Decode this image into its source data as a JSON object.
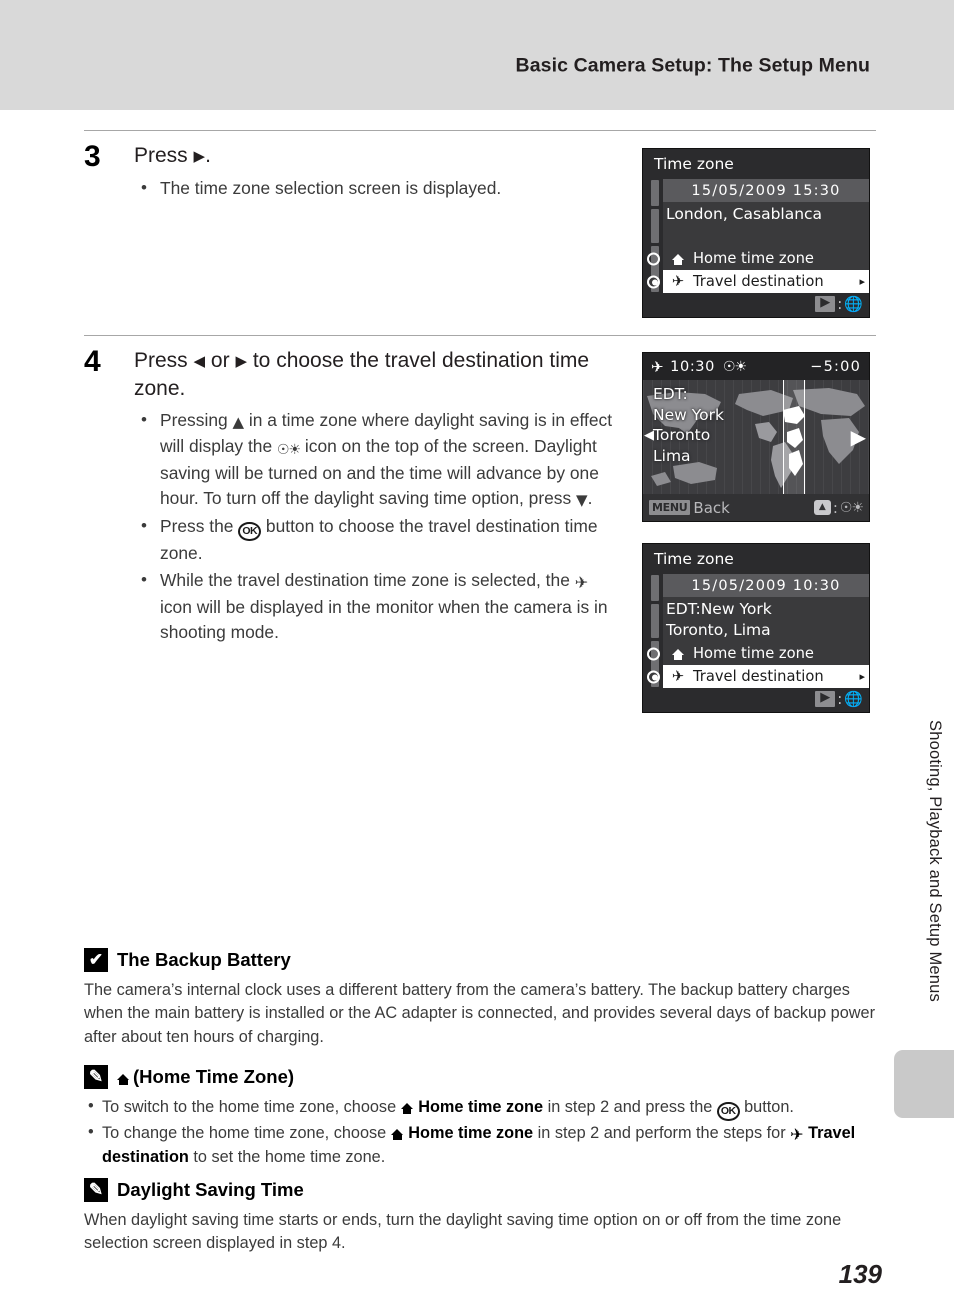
{
  "header": {
    "title": "Basic Camera Setup: The Setup Menu"
  },
  "steps": [
    {
      "number": "3",
      "title_pre": "Press",
      "title_icon": "▶",
      "title_post": ".",
      "bullets": [
        {
          "text": "The time zone selection screen is displayed."
        }
      ]
    },
    {
      "number": "4",
      "title_line1_a": "Press",
      "title_icon_left": "◀",
      "title_or": "or",
      "title_icon_right": "▶",
      "title_line1_b": "to choose the travel destination",
      "title_line2": "time zone.",
      "bullets": [
        {
          "p1": "Pressing",
          "icon1": "▲",
          "p2": "in a time zone where daylight saving is in effect will display the",
          "icon2": "dst-icon",
          "p3": "icon on the top of the screen. Daylight saving will be turned on and the time will advance by one hour. To turn off the daylight saving time option, press",
          "icon3": "▼",
          "p4": "."
        },
        {
          "p1": "Press the",
          "icon1": "OK",
          "p2": "button to choose the travel destination time zone."
        },
        {
          "p1": "While the travel destination time zone is selected, the",
          "icon1": "travel-plane-icon",
          "p2": "icon will be displayed in the monitor when the camera is in shooting mode."
        }
      ]
    }
  ],
  "screens": {
    "menu_home": {
      "title": "Time zone",
      "datetime": "15/05/2009  15:30",
      "location_lines": [
        "London, Casablanca"
      ],
      "options": [
        {
          "label": "Home time zone",
          "icon": "home-icon",
          "selected": false
        },
        {
          "label": "Travel destination",
          "icon": "plane-icon",
          "selected": true,
          "arrow": "▸"
        }
      ],
      "footer": {
        "button": "▶",
        "sep": ":",
        "icon": "globe-icon"
      }
    },
    "map": {
      "top": {
        "plane_icon": "✈",
        "time": "10:30",
        "dst_icon": "dst-icon",
        "offset": "−5:00"
      },
      "cities": [
        "EDT:",
        "New York",
        "Toronto",
        "Lima"
      ],
      "cursor_left": "◀",
      "cursor_right": "▶",
      "footer": {
        "menu": "MENU",
        "back": "Back",
        "pad": "⬍",
        "sep": ":",
        "icon": "dst-icon"
      }
    },
    "menu_travel": {
      "title": "Time zone",
      "datetime": "15/05/2009  10:30",
      "location_lines": [
        "EDT:New York",
        "Toronto, Lima"
      ],
      "options": [
        {
          "label": "Home time zone",
          "icon": "home-icon",
          "selected": false
        },
        {
          "label": "Travel destination",
          "icon": "plane-icon",
          "selected": true,
          "arrow": "▸"
        }
      ],
      "footer": {
        "button": "▶",
        "sep": ":",
        "icon": "globe-icon"
      }
    }
  },
  "notes": [
    {
      "badge": "✔",
      "title": "The Backup Battery",
      "body": "The camera’s internal clock uses a different battery from the camera’s battery. The backup battery charges when the main battery is installed or the AC adapter is connected, and provides several days of backup power after about ten hours of charging."
    },
    {
      "badge": "✎",
      "title_icon": "home-icon",
      "title": "(Home Time Zone)",
      "bullets": [
        {
          "p1": "To switch to the home time zone, choose",
          "icon1": "home-icon",
          "b1": "Home time zone",
          "p2": "in step 2 and press the",
          "icon2": "OK",
          "p3": "button."
        },
        {
          "p1": "To change the home time zone, choose",
          "icon1": "home-icon",
          "b1": "Home time zone",
          "p2": "in step 2 and perform the steps for",
          "icon2": "plane-icon",
          "b2": "Travel destination",
          "p3": "to set the home time zone."
        }
      ]
    },
    {
      "badge": "✎",
      "title": "Daylight Saving Time",
      "body": "When daylight saving time starts or ends, turn the daylight saving time option on or off from the time zone selection screen displayed in step 4."
    }
  ],
  "side": {
    "chapter": "Shooting, Playback and Setup Menus"
  },
  "page_number": "139"
}
